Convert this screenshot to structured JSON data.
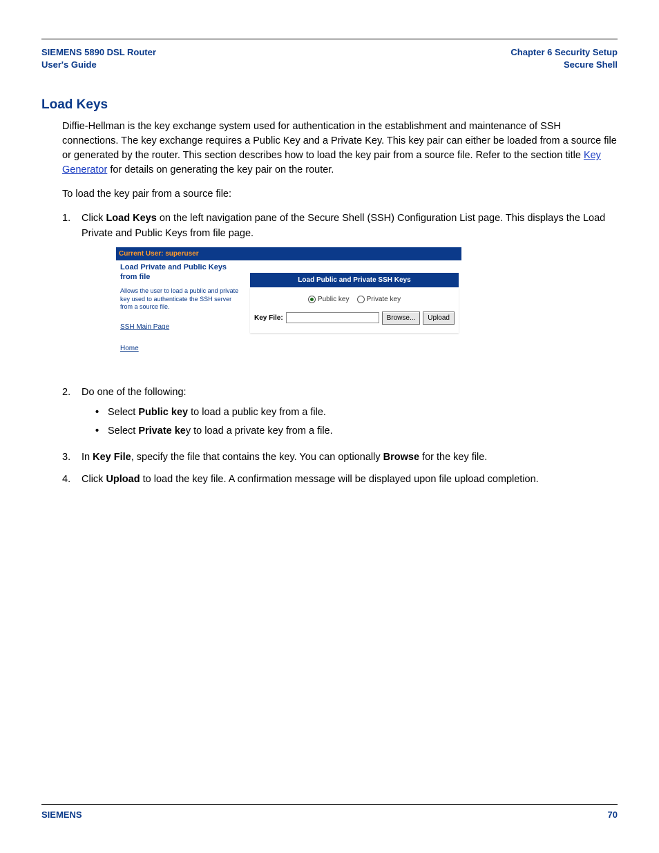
{
  "header": {
    "left_line1": "SIEMENS 5890 DSL Router",
    "left_line2": "User's Guide",
    "right_line1": "Chapter 6  Security Setup",
    "right_line2": "Secure Shell"
  },
  "section_title": "Load Keys",
  "intro": {
    "p1_a": "Diffie-Hellman is the key exchange system used for authentication in the establishment and maintenance of SSH connections. The key exchange requires a Public Key and a Private Key. This key pair can either be loaded from a source file or generated by the router. This section describes how to load the key pair from a source file. Refer to the section title ",
    "p1_link": "Key Generator",
    "p1_b": " for details on generating the key pair on the router.",
    "p2": "To load the key pair from a source file:"
  },
  "steps": {
    "s1_a": "Click ",
    "s1_b": "Load Keys",
    "s1_c": " on the left navigation pane of the Secure Shell (SSH) Configuration List page. This displays the Load Private and Public Keys from file page.",
    "s2": "Do one of the following:",
    "s2_b1_a": "Select ",
    "s2_b1_b": "Public key",
    "s2_b1_c": " to load a public key from a file.",
    "s2_b2_a": "Select ",
    "s2_b2_b": "Private ke",
    "s2_b2_c": "y to load a private key from a file.",
    "s3_a": "In ",
    "s3_b": "Key File",
    "s3_c": ", specify the file that contains the key. You can optionally ",
    "s3_d": "Browse",
    "s3_e": " for the key file.",
    "s4_a": "Click ",
    "s4_b": "Upload",
    "s4_c": " to load the key file. A confirmation message will be displayed upon file upload completion."
  },
  "screenshot": {
    "topbar": "Current User: superuser",
    "left_title": "Load Private and Public Keys from file",
    "left_desc": "Allows the user to load a public and private key used to authenticate the SSH server from a source file.",
    "link_ssh": "SSH Main Page",
    "link_home": "Home",
    "panel_head": "Load Public and Private SSH Keys",
    "radio_public": "Public key",
    "radio_private": "Private key",
    "file_label": "Key File:",
    "browse": "Browse...",
    "upload": "Upload"
  },
  "footer": {
    "left": "SIEMENS",
    "right": "70"
  }
}
